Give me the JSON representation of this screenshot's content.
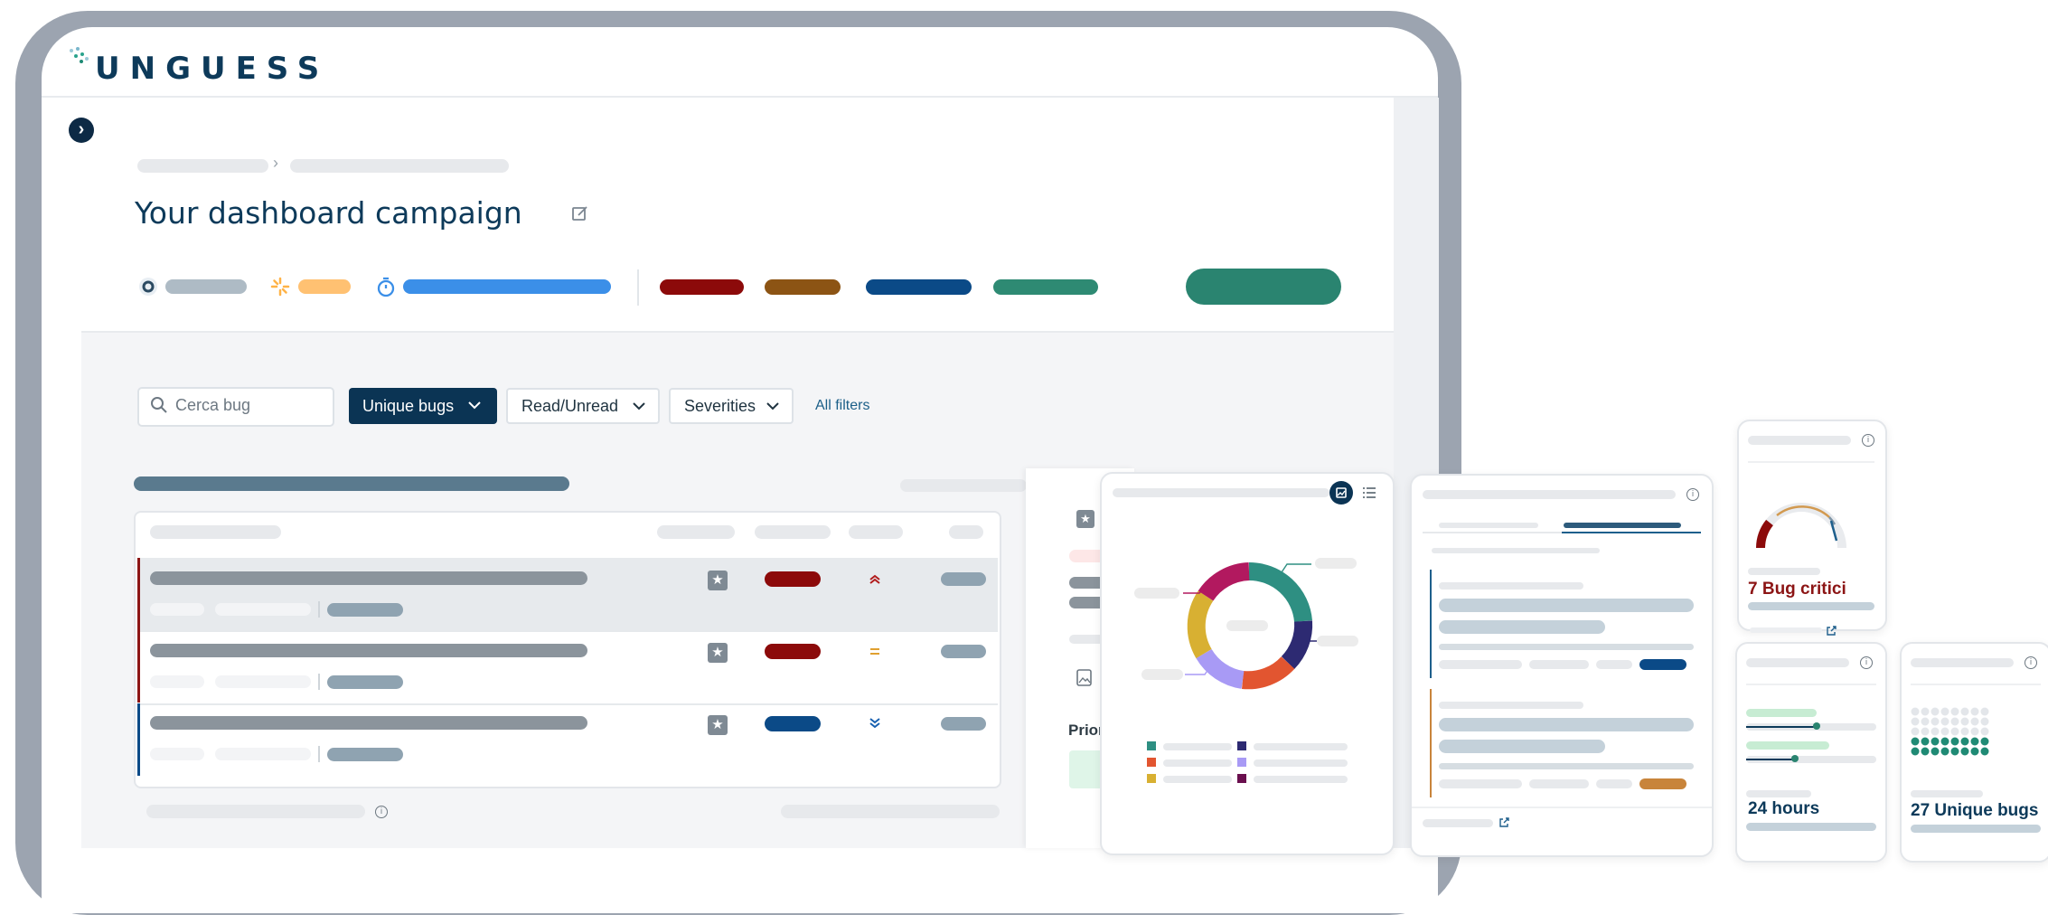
{
  "app": {
    "logo_text": "UNGUESS"
  },
  "header": {
    "title": "Your dashboard campaign"
  },
  "filters": {
    "search_placeholder": "Cerca bug",
    "unique_bugs_label": "Unique bugs",
    "read_unread_label": "Read/Unread",
    "severities_label": "Severities",
    "all_filters_label": "All filters"
  },
  "detail_panel": {
    "priority_label": "Prior"
  },
  "widgets": {
    "critical_bugs": "7 Bug critici",
    "duration": "24 hours",
    "unique_bugs": "27 Unique bugs"
  },
  "icons": [
    "chevron-right-icon",
    "edit-icon",
    "gear-icon",
    "loading-icon",
    "stopwatch-icon",
    "search-icon",
    "chevron-down-icon",
    "star-icon",
    "priority-high-icon",
    "priority-medium-icon",
    "priority-low-icon",
    "info-icon",
    "chart-icon",
    "list-icon",
    "external-link-icon",
    "image-icon"
  ],
  "colors": {
    "brand_dark": "#0b3454",
    "accent_green": "#2a8470",
    "critical": "#8c0a0a",
    "high": "#8c5414",
    "medium": "#0b4a87",
    "low": "#2e8a73",
    "in_progress": "#3b8fe8",
    "pending": "#ffc172",
    "donut": [
      "#2e8f82",
      "#2d2a72",
      "#e25530",
      "#a89af5",
      "#d8b032",
      "#b2195f"
    ]
  }
}
